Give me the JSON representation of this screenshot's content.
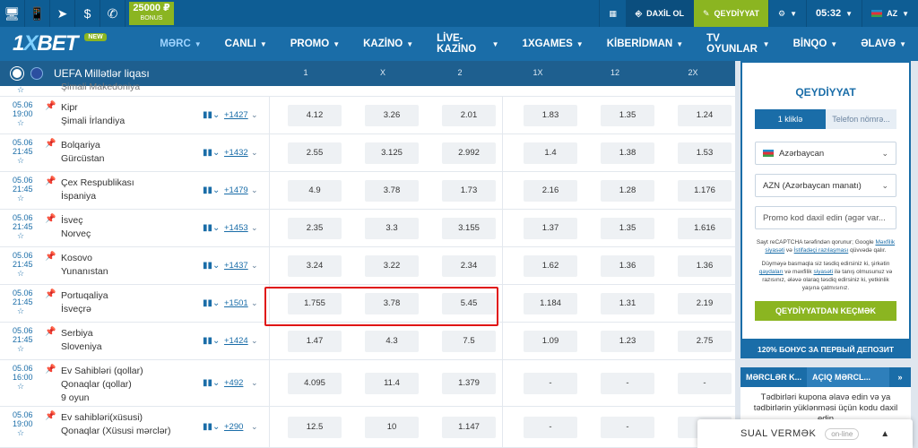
{
  "topbar": {
    "icons": [
      "desktop-icon",
      "mobile-icon",
      "telegram-icon",
      "dollar-icon",
      "phone-icon"
    ],
    "bonus_amount": "25000 ₽",
    "bonus_label": "BONUS",
    "qr_label": "",
    "login_label": "DAXİL OL",
    "register_label": "QEYDİYYAT",
    "time": "05:32",
    "lang": "AZ"
  },
  "nav": {
    "logo_one": "1",
    "logo_x": "X",
    "logo_bet": "BET",
    "new_badge": "NEW",
    "items": [
      "MƏRC",
      "CANLI",
      "PROMO",
      "KAZİNO",
      "LİVE-KAZİNO",
      "1XGAMES",
      "KİBERİDMAN",
      "TV OYUNLAR",
      "BİNQO",
      "ƏLAVƏ"
    ]
  },
  "league": {
    "name": "UEFA Millətlər liqası",
    "columns": [
      "1",
      "X",
      "2",
      "1X",
      "12",
      "2X"
    ]
  },
  "partial_row_team": "Şimali Makedoniya",
  "matches": [
    {
      "date": "05.06",
      "time": "19:00",
      "team1": "Kipr",
      "team2": "Şimali İrlandiya",
      "team3": "",
      "more": "+1427",
      "odds": [
        "4.12",
        "3.26",
        "2.01",
        "1.83",
        "1.35",
        "1.24"
      ]
    },
    {
      "date": "05.06",
      "time": "21:45",
      "team1": "Bolqariya",
      "team2": "Gürcüstan",
      "team3": "",
      "more": "+1432",
      "odds": [
        "2.55",
        "3.125",
        "2.992",
        "1.4",
        "1.38",
        "1.53"
      ]
    },
    {
      "date": "05.06",
      "time": "21:45",
      "team1": "Çex Respublikası",
      "team2": "İspaniya",
      "team3": "",
      "more": "+1479",
      "odds": [
        "4.9",
        "3.78",
        "1.73",
        "2.16",
        "1.28",
        "1.176"
      ]
    },
    {
      "date": "05.06",
      "time": "21:45",
      "team1": "İsveç",
      "team2": "Norveç",
      "team3": "",
      "more": "+1453",
      "odds": [
        "2.35",
        "3.3",
        "3.155",
        "1.37",
        "1.35",
        "1.616"
      ]
    },
    {
      "date": "05.06",
      "time": "21:45",
      "team1": "Kosovo",
      "team2": "Yunanıstan",
      "team3": "",
      "more": "+1437",
      "odds": [
        "3.24",
        "3.22",
        "2.34",
        "1.62",
        "1.36",
        "1.36"
      ]
    },
    {
      "date": "05.06",
      "time": "21:45",
      "team1": "Portuqaliya",
      "team2": "İsveçrə",
      "team3": "",
      "more": "+1501",
      "odds": [
        "1.755",
        "3.78",
        "5.45",
        "1.184",
        "1.31",
        "2.19"
      ]
    },
    {
      "date": "05.06",
      "time": "21:45",
      "team1": "Serbiya",
      "team2": "Sloveniya",
      "team3": "",
      "more": "+1424",
      "odds": [
        "1.47",
        "4.3",
        "7.5",
        "1.09",
        "1.23",
        "2.75"
      ]
    },
    {
      "date": "05.06",
      "time": "16:00",
      "team1": "Ev Sahibləri (qollar)",
      "team2": "Qonaqlar (qollar)",
      "team3": "9 oyun",
      "more": "+492",
      "odds": [
        "4.095",
        "11.4",
        "1.379",
        "-",
        "-",
        "-"
      ]
    },
    {
      "date": "05.06",
      "time": "19:00",
      "team1": "Ev sahibləri(xüsusi)",
      "team2": "Qonaqlar (Xüsusi mərclər)",
      "team3": "",
      "more": "+290",
      "odds": [
        "12.5",
        "10",
        "1.147",
        "-",
        "-",
        "-"
      ]
    }
  ],
  "sidebar": {
    "title": "QEYDİYYAT",
    "tab_active": "1 kliklə",
    "tab_inactive": "Telefon nömrə...",
    "country": "Azərbaycan",
    "currency": "AZN (Azərbaycan manatı)",
    "promo_placeholder": "Promo kod daxil edin (əgər var...",
    "recaptcha_1": "Sayt reCAPTCHA tərəfindən qorunur; Google",
    "recaptcha_link1": "Məxfilik siyasəti",
    "recaptcha_and": "və",
    "recaptcha_link2": "İstifadəçi razılaşması",
    "recaptcha_2": "qüvvədə qalır.",
    "terms_1": "Düyməyə basmaqla siz təsdiq edirsiniz ki, şirkətin",
    "terms_link1": "qaydaları",
    "terms_and": "və məxfilik",
    "terms_link2": "siyasəti",
    "terms_2": "ilə tanış olmusunuz və razısınız, ələvə olaraq təsdiq edirsiniz ki, yetkinlik yaşına çatmısınız.",
    "submit": "QEYDİYYATDAN KEÇMƏK",
    "promo_banner": "120% БОНУС ЗА ПЕРВЫЙ ДЕПОЗИТ",
    "bet_tab1": "MƏRCLƏR K...",
    "bet_tab2": "AÇIQ MƏRCL...",
    "bet_tab3": "»",
    "bet_info": "Tədbirləri kupona əlavə edin və ya tədbirlərin yüklənməsi üçün kodu daxil edin"
  },
  "support": {
    "label": "SUAL VERMƏK",
    "status": "on-line"
  }
}
